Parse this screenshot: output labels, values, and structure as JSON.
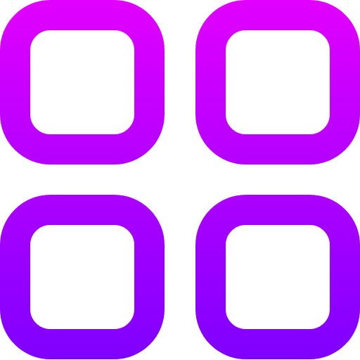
{
  "icon": {
    "name": "grid-four-squares-icon",
    "style": "outlined rounded squares, 2x2 grid",
    "gradient": {
      "direction": "top-to-bottom",
      "start_color": "#e100ff",
      "end_color": "#7f00ff"
    },
    "background_color": "#ffffff"
  }
}
